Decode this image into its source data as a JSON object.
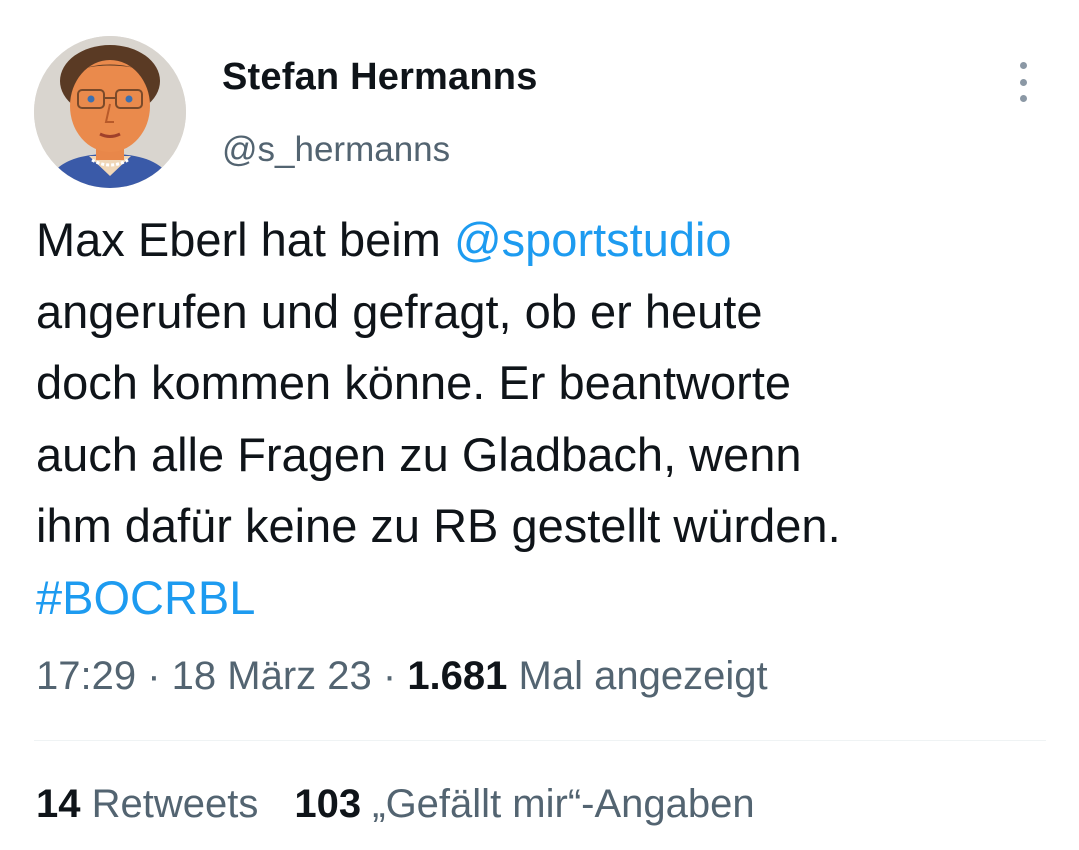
{
  "author": {
    "name": "Stefan Hermanns",
    "handle": "@s_hermanns",
    "avatar_icon": "portrait-drawing-avatar"
  },
  "menu_icon": "more-options-icon",
  "tweet": {
    "lines": [
      [
        {
          "text": "Max Eberl hat beim ",
          "link": false
        },
        {
          "text": "@sportstudio",
          "link": true
        }
      ],
      [
        {
          "text": "angerufen und gefragt, ob er heute",
          "link": false
        }
      ],
      [
        {
          "text": "doch kommen könne. Er beantworte",
          "link": false
        }
      ],
      [
        {
          "text": "auch alle Fragen zu Gladbach, wenn",
          "link": false
        }
      ],
      [
        {
          "text": "ihm dafür keine zu RB gestellt würden.",
          "link": false
        }
      ],
      [
        {
          "text": "#BOCRBL",
          "link": true
        }
      ]
    ]
  },
  "meta": {
    "time": "17:29",
    "separator": " · ",
    "date": "18 März 23",
    "views_count": "1.681",
    "views_label": "Mal angezeigt"
  },
  "stats": {
    "retweets_count": "14",
    "retweets_label": "Retweets",
    "likes_count": "103",
    "likes_label": "„Gefällt mir“-Angaben"
  },
  "colors": {
    "text": "#0f1419",
    "secondary": "#536471",
    "link": "#1d9bf0",
    "divider": "#eff3f4"
  }
}
